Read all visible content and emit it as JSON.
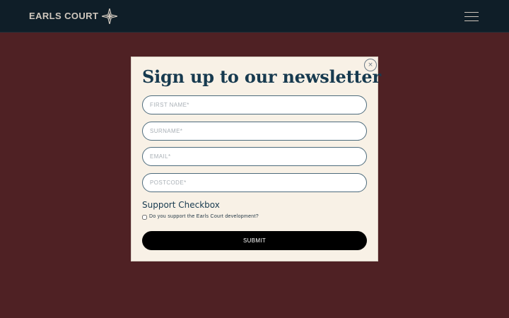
{
  "header": {
    "logo_text": "EARLS COURT",
    "logo_icon": "compass-star-icon",
    "menu_icon": "hamburger-menu-icon"
  },
  "modal": {
    "title": "Sign up to our newsletter",
    "close_label": "×",
    "fields": {
      "first_name": {
        "placeholder": "FIRST NAME*",
        "value": ""
      },
      "surname": {
        "placeholder": "SURNAME*",
        "value": ""
      },
      "email": {
        "placeholder": "EMAIL*",
        "value": ""
      },
      "postcode": {
        "placeholder": "POSTCODE*",
        "value": ""
      }
    },
    "support": {
      "title": "Support Checkbox",
      "checkbox_label": "Do you support the Earls Court development?",
      "checked": false
    },
    "submit_label": "SUBMIT"
  },
  "colors": {
    "page_background": "#4f2124",
    "header_background": "#0f1e28",
    "modal_background": "#f8f1e6",
    "title_color": "#173a4f",
    "field_border": "#4d6b7c",
    "submit_background": "#000000"
  }
}
